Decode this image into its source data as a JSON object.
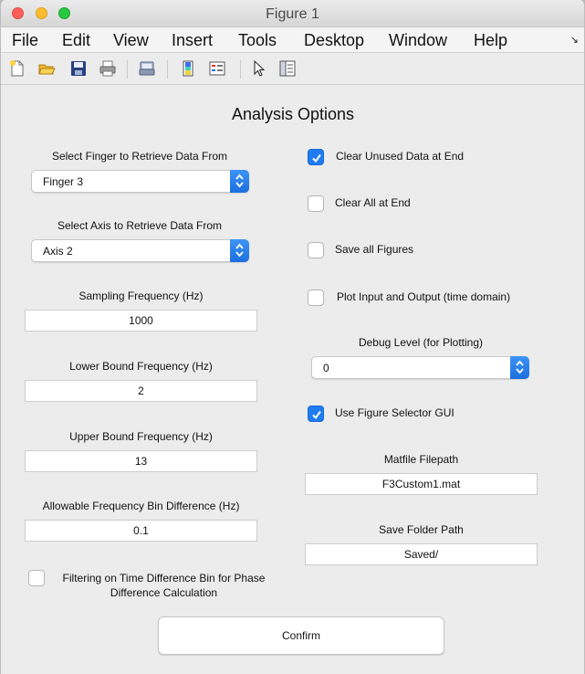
{
  "window": {
    "title": "Figure 1"
  },
  "menu": [
    "File",
    "Edit",
    "View",
    "Insert",
    "Tools",
    "Desktop",
    "Window",
    "Help"
  ],
  "toolbar": {
    "icons": [
      "new-file-icon",
      "open-folder-icon",
      "save-icon",
      "print-icon",
      "print-preview-icon",
      "colorbar-icon",
      "legend-icon",
      "pointer-icon",
      "property-editor-icon"
    ]
  },
  "panel": {
    "heading": "Analysis Options",
    "finger": {
      "label": "Select Finger to Retrieve Data From",
      "value": "Finger 3"
    },
    "axis": {
      "label": "Select Axis to Retrieve Data From",
      "value": "Axis 2"
    },
    "sampling": {
      "label": "Sampling Frequency (Hz)",
      "value": "1000"
    },
    "lower": {
      "label": "Lower Bound Frequency (Hz)",
      "value": "2"
    },
    "upper": {
      "label": "Upper Bound Frequency (Hz)",
      "value": "13"
    },
    "bin_diff": {
      "label": "Allowable Frequency Bin Difference (Hz)",
      "value": "0.1"
    },
    "filtering": {
      "label_line1": "Filtering on Time Difference Bin for Phase",
      "label_line2": "Difference Calculation",
      "checked": false
    },
    "clear_unused": {
      "label": "Clear Unused Data at End",
      "checked": true
    },
    "clear_all": {
      "label": "Clear All at End",
      "checked": false
    },
    "save_figures": {
      "label": "Save all Figures",
      "checked": false
    },
    "plot_io": {
      "label": "Plot Input and Output (time domain)",
      "checked": false
    },
    "debug": {
      "label": "Debug Level (for Plotting)",
      "value": "0"
    },
    "figure_selector": {
      "label": "Use Figure Selector GUI",
      "checked": true
    },
    "matfile": {
      "label": "Matfile Filepath",
      "value": "F3Custom1.mat"
    },
    "save_folder": {
      "label": "Save Folder Path",
      "value": "Saved/"
    },
    "confirm_label": "Confirm"
  },
  "colors": {
    "accent": "#1f7cf2",
    "background": "#ececec"
  }
}
